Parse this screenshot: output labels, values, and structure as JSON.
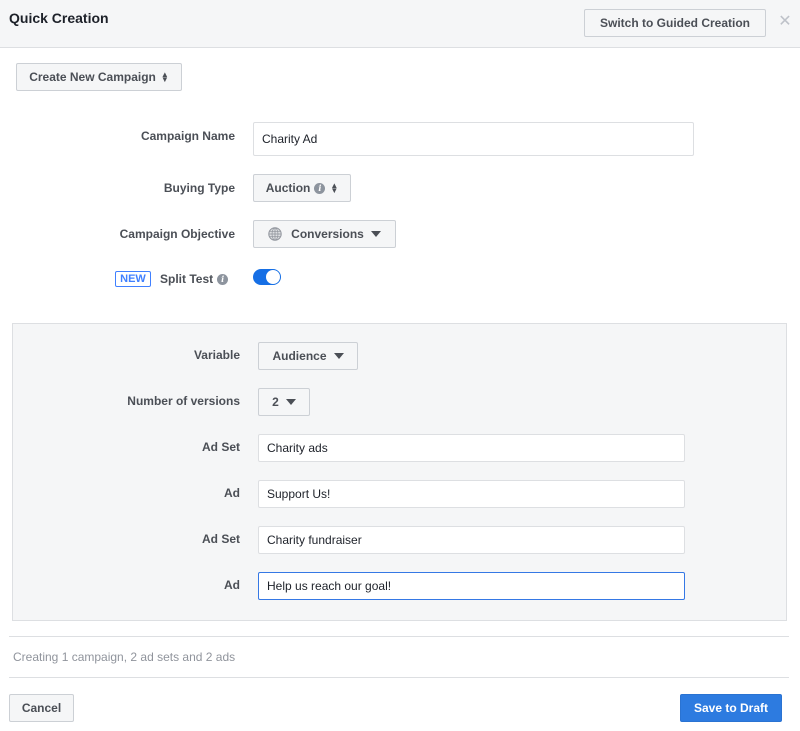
{
  "header": {
    "title": "Quick Creation",
    "switch_button": "Switch to Guided Creation",
    "close_icon": "close-icon"
  },
  "campaign_selector": {
    "label": "Create New Campaign"
  },
  "form": {
    "campaign_name": {
      "label": "Campaign Name",
      "value": "Charity Ad"
    },
    "buying_type": {
      "label": "Buying Type",
      "value": "Auction",
      "icon": "info-icon"
    },
    "campaign_objective": {
      "label": "Campaign Objective",
      "value": "Conversions",
      "icon": "globe-icon"
    },
    "split_test": {
      "badge": "NEW",
      "label": "Split Test",
      "enabled": true
    }
  },
  "split_test_panel": {
    "variable": {
      "label": "Variable",
      "value": "Audience"
    },
    "versions": {
      "label": "Number of versions",
      "value": "2"
    },
    "rows": [
      {
        "label": "Ad Set",
        "value": "Charity ads"
      },
      {
        "label": "Ad",
        "value": "Support Us!"
      },
      {
        "label": "Ad Set",
        "value": "Charity fundraiser"
      },
      {
        "label": "Ad",
        "value": "Help us reach our goal!",
        "focused": true
      }
    ]
  },
  "summary": "Creating 1 campaign, 2 ad sets and 2 ads",
  "footer": {
    "cancel": "Cancel",
    "save": "Save to Draft"
  },
  "colors": {
    "accent": "#4080ff",
    "primary_button": "#2d7be0",
    "toggle_on": "#166fe5",
    "panel_bg": "#f5f6f7"
  }
}
